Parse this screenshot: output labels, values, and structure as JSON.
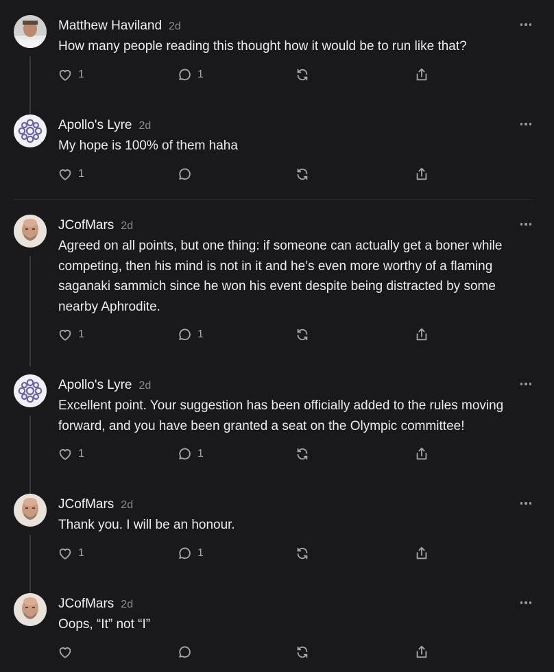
{
  "comments": [
    {
      "author": "Matthew Haviland",
      "time": "2d",
      "text": "How many people reading this thought how it would be to run like that?",
      "likes": "1",
      "replies": "1",
      "avatar": "person-photo-avatar"
    },
    {
      "author": "Apollo's Lyre",
      "time": "2d",
      "text": "My hope is 100% of them haha",
      "likes": "1",
      "replies": "",
      "avatar": "pattern-avatar"
    },
    {
      "author": "JCofMars",
      "time": "2d",
      "text": "Agreed on all points, but one thing: if someone can actually get a boner while competing, then his mind is not in it and he’s even more worthy of a flaming saganaki sammich since he won his event despite being distracted by some nearby Aphrodite.",
      "likes": "1",
      "replies": "1",
      "avatar": "bald-man-avatar"
    },
    {
      "author": "Apollo's Lyre",
      "time": "2d",
      "text": "Excellent point. Your suggestion has been officially added to the rules moving forward, and you have been granted a seat on the Olympic committee!",
      "likes": "1",
      "replies": "1",
      "avatar": "pattern-avatar"
    },
    {
      "author": "JCofMars",
      "time": "2d",
      "text": "Thank you. I will be an honour.",
      "likes": "1",
      "replies": "1",
      "avatar": "bald-man-avatar"
    },
    {
      "author": "JCofMars",
      "time": "2d",
      "text": "Oops, “It” not “I”",
      "likes": "",
      "replies": "",
      "avatar": "bald-man-avatar"
    }
  ],
  "icons": {
    "like": "heart-icon",
    "reply": "comment-bubble-icon",
    "restack": "restack-arrows-icon",
    "share": "share-upload-icon",
    "more": "more-dots-icon"
  },
  "colors": {
    "background": "#19191b",
    "text": "#ececee",
    "muted": "#8b8b90",
    "icon": "#a6a6ab",
    "thread_line": "#3a3a3e"
  }
}
